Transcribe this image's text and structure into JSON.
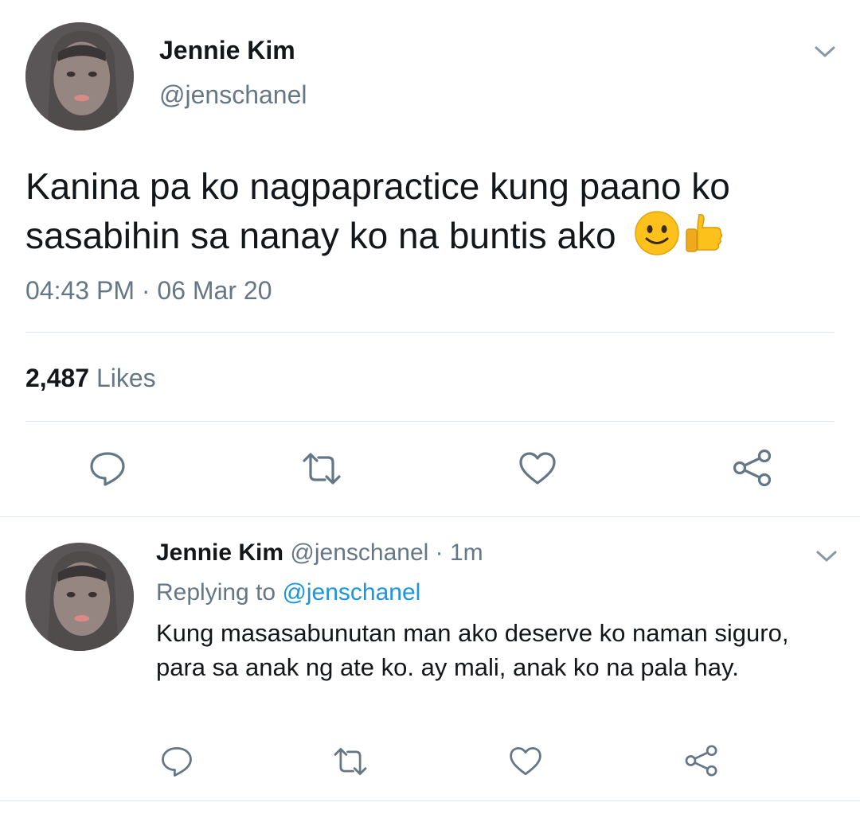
{
  "main_tweet": {
    "display_name": "Jennie Kim",
    "handle": "@jenschanel",
    "text": "Kanina pa ko nagpapractice kung paano ko sasabihin sa nanay ko na buntis ako",
    "emojis": [
      "slightly-smiling-face",
      "thumbs-up"
    ],
    "timestamp": "04:43 PM · 06 Mar 20",
    "likes_count": "2,487",
    "likes_label": "Likes",
    "menu_icon": "chevron-down-icon",
    "actions": [
      "reply-icon",
      "retweet-icon",
      "like-icon",
      "share-icon"
    ]
  },
  "reply_tweet": {
    "display_name": "Jennie Kim",
    "handle": "@jenschanel",
    "time_sep": "·",
    "time_ago": "1m",
    "replying_to_label": "Replying to",
    "replying_to_handle": "@jenschanel",
    "text": "Kung masasabunutan man ako deserve ko naman siguro, para sa anak ng ate ko. ay mali, anak ko na pala hay.",
    "menu_icon": "chevron-down-icon",
    "actions": [
      "reply-icon",
      "retweet-icon",
      "like-icon",
      "share-icon"
    ]
  },
  "colors": {
    "text": "#14171a",
    "secondary": "#657786",
    "link": "#1b95e0",
    "divider": "#e1e8ed"
  }
}
